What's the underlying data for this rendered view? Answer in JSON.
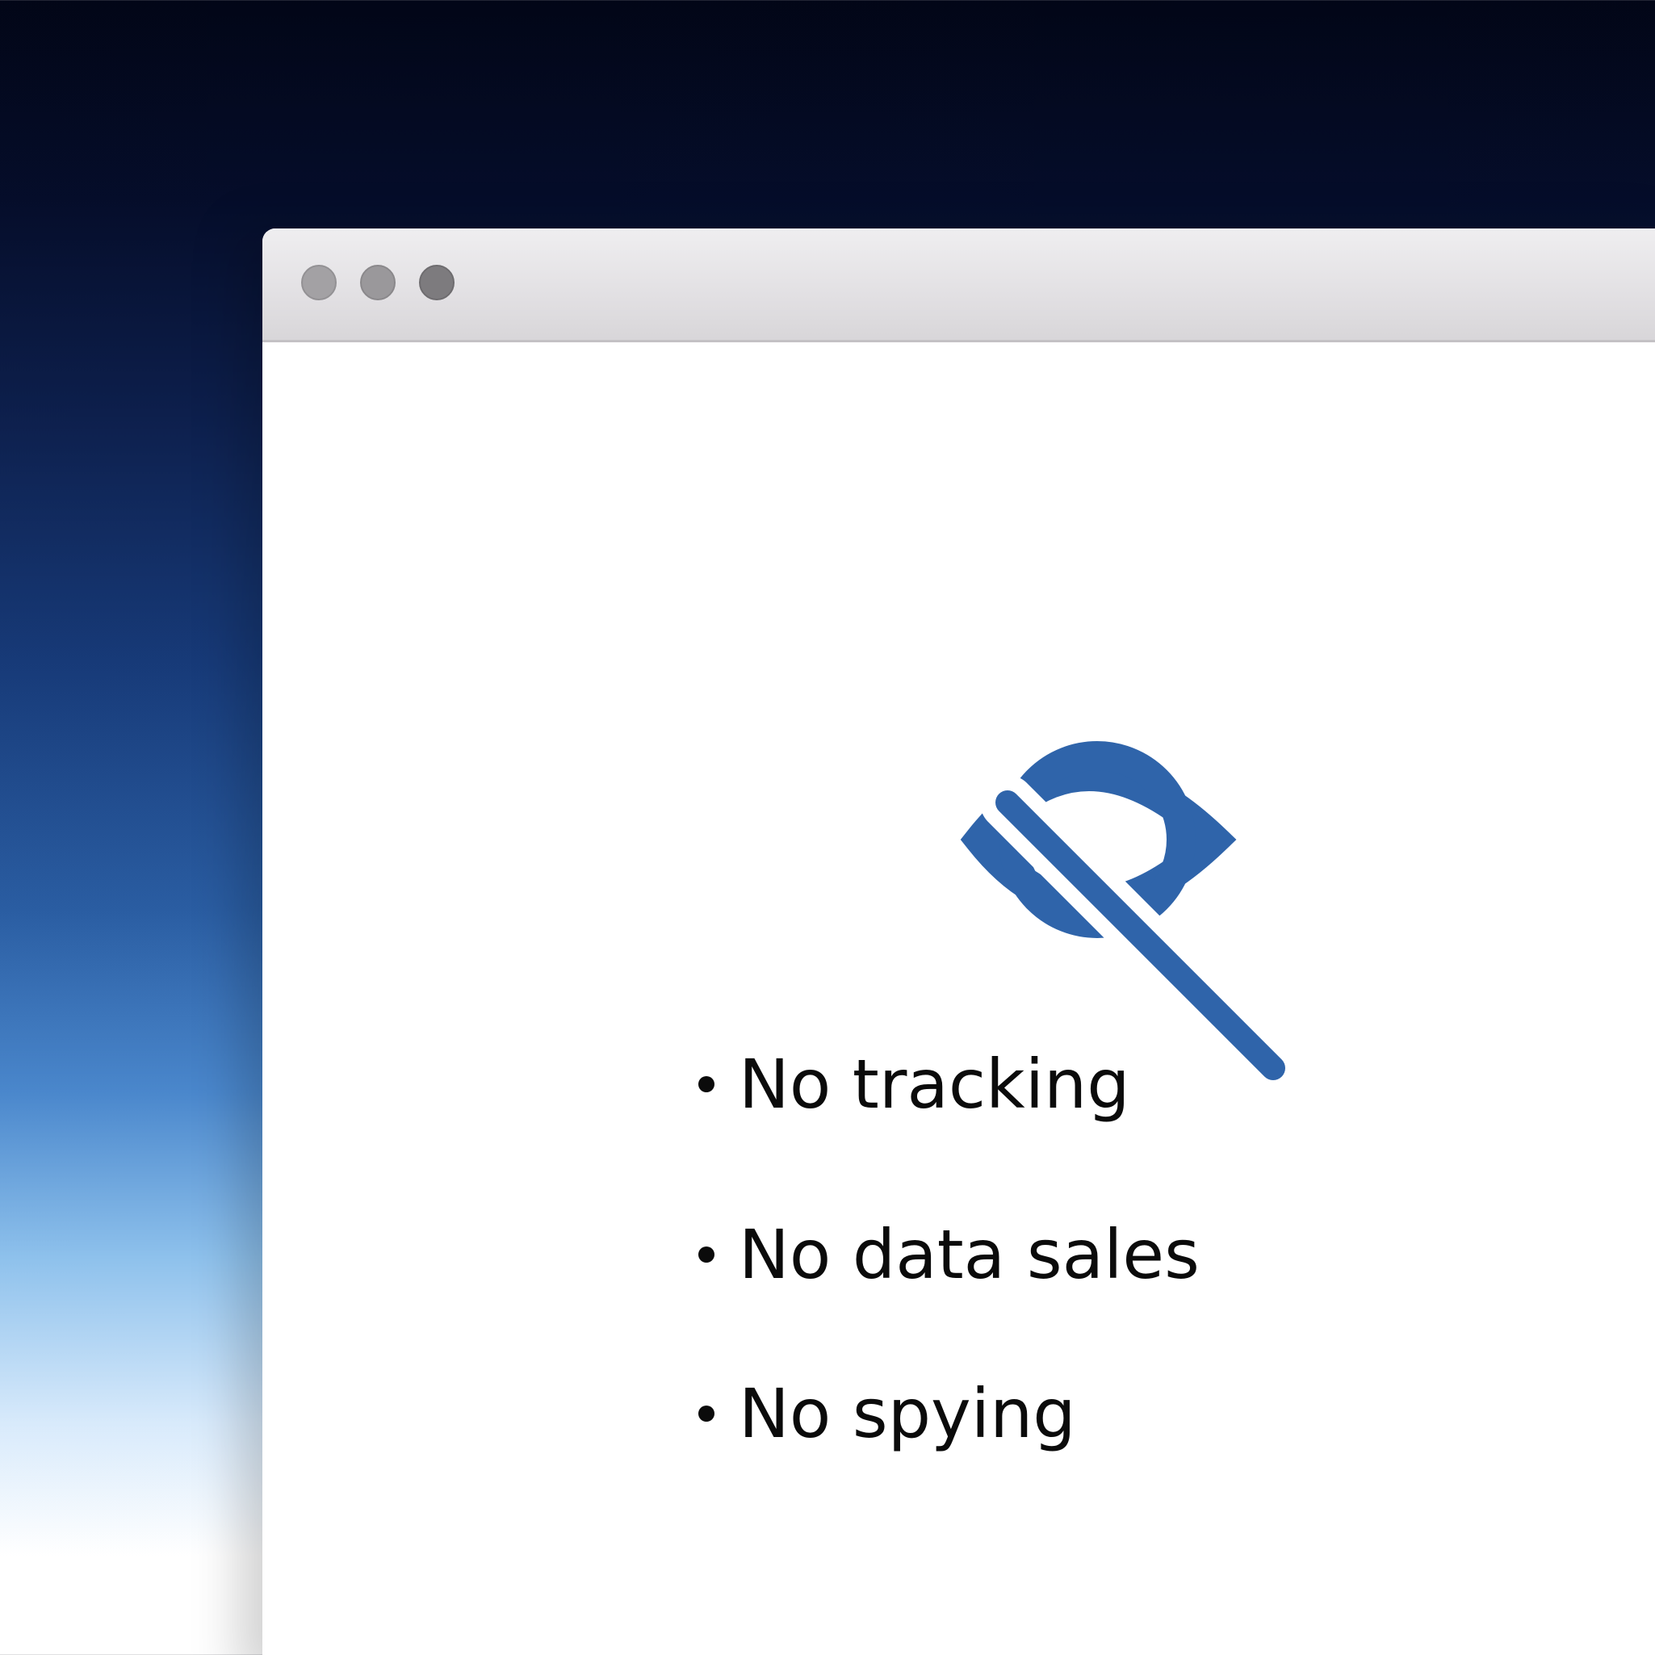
{
  "window": {
    "title_bar": {
      "buttons": [
        {
          "name": "close",
          "color": "#a3a1a4"
        },
        {
          "name": "minimize",
          "color": "#9a989b"
        },
        {
          "name": "zoom",
          "color": "#7d7b7e"
        }
      ]
    }
  },
  "hero": {
    "icon": "eye-slash-icon",
    "icon_color": "#2f64aa"
  },
  "features": [
    {
      "text": "No tracking"
    },
    {
      "text": "No data sales"
    },
    {
      "text": "No spying"
    }
  ],
  "colors": {
    "background_top": "#020617",
    "background_mid": "#2a5da2",
    "background_bottom": "#ffffff",
    "text": "#0b0b0b"
  }
}
